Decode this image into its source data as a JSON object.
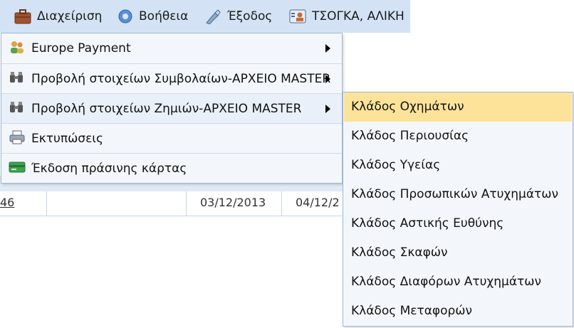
{
  "menubar": {
    "items": [
      {
        "label": "Διαχείριση",
        "icon": "briefcase-icon"
      },
      {
        "label": "Βοήθεια",
        "icon": "help-icon"
      },
      {
        "label": "Έξοδος",
        "icon": "exit-icon"
      },
      {
        "label": "ΤΣΟΓΚΑ, ΑΛΙΚΗ",
        "icon": "user-card-icon"
      }
    ]
  },
  "dropdown": {
    "items": [
      {
        "label": "Europe Payment",
        "icon": "users-icon",
        "has_submenu": true
      },
      {
        "label": "Προβολή στοιχείων Συμβολαίων-ΑΡΧΕΙΟ MASTER",
        "icon": "binoculars-icon",
        "has_submenu": true
      },
      {
        "label": "Προβολή στοιχείων Ζημιών-ΑΡΧΕΙΟ MASTER",
        "icon": "binoculars-icon",
        "has_submenu": true
      },
      {
        "label": "Εκτυπώσεις",
        "icon": "printer-icon",
        "has_submenu": false
      },
      {
        "label": "Έκδοση πράσινης κάρτας",
        "icon": "green-card-icon",
        "has_submenu": false
      }
    ]
  },
  "submenu": {
    "items": [
      {
        "label": "Κλάδος Οχημάτων",
        "active": true
      },
      {
        "label": "Κλάδος Περιουσίας",
        "active": false
      },
      {
        "label": "Κλάδος Υγείας",
        "active": false
      },
      {
        "label": "Κλάδος Προσωπικών Ατυχημάτων",
        "active": false
      },
      {
        "label": "Κλάδος Αστικής Ευθύνης",
        "active": false
      },
      {
        "label": "Κλάδος Σκαφών",
        "active": false
      },
      {
        "label": "Κλάδος Διαφόρων Ατυχημάτων",
        "active": false
      },
      {
        "label": "Κλάδος Μεταφορών",
        "active": false
      }
    ]
  },
  "background_table": {
    "row": {
      "link": "46",
      "date1": "03/12/2013",
      "date2": "04/12/2"
    }
  },
  "colors": {
    "menubar_bg": "#d3e3f5",
    "menu_bg": "#f3f7fc",
    "active_item_bg": "#fde39a",
    "border": "#9fb6d0"
  }
}
